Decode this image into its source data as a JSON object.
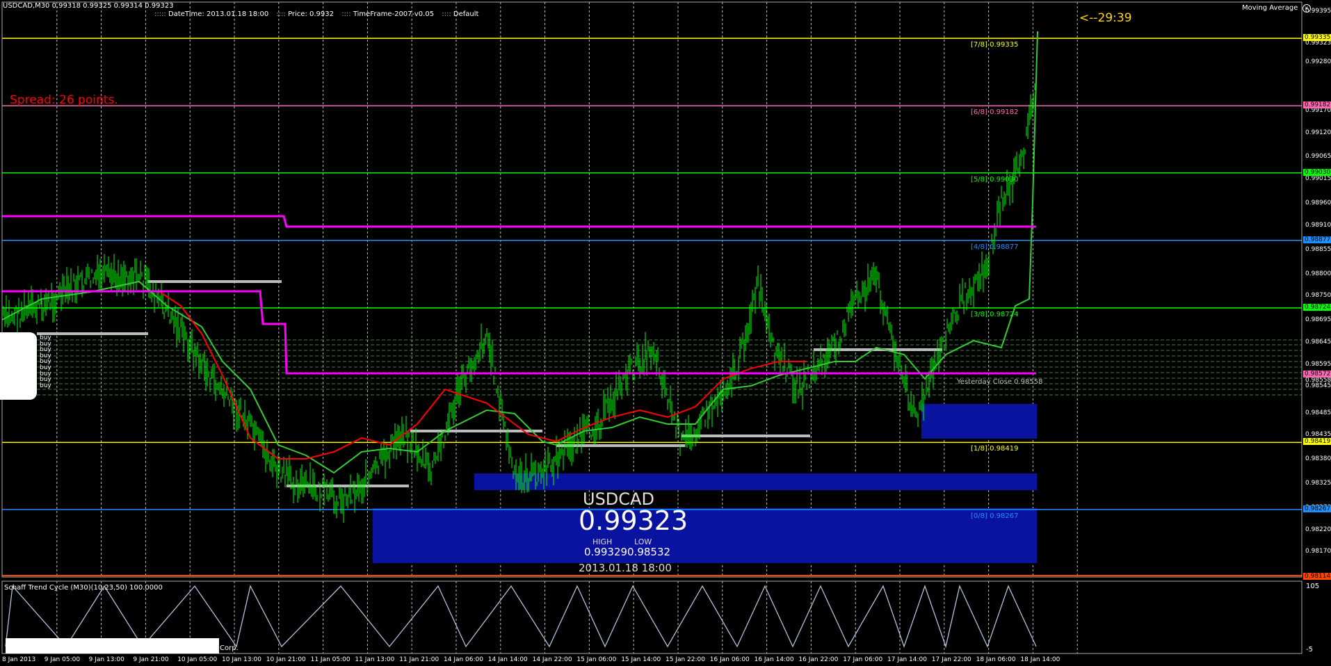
{
  "header": {
    "symbol_tf": "USDCAD,M30",
    "ohlc": "0.99318 0.99325 0.99314 0.99323",
    "datetime_label": "DateTime: 2013.01.18 18:00",
    "price_label": "Price: 0.9932",
    "timeframe_label": "TimeFrame-2007-v0.05",
    "default_label": "Default",
    "ma_label": "Moving Average",
    "countdown": "<--29:39"
  },
  "spread_text": "Spread: 26 points.",
  "murrey": [
    {
      "label": "[7/8]",
      "value": "0.99335",
      "color": "#ffff00"
    },
    {
      "label": "[6/8]",
      "value": "0.99182",
      "color": "#ff69b4"
    },
    {
      "label": "[5/8]",
      "value": "0.99030",
      "color": "#00ff00"
    },
    {
      "label": "[4/8]",
      "value": "0.98877",
      "color": "#1e90ff"
    },
    {
      "label": "[3/8]",
      "value": "0.98724",
      "color": "#00ff00"
    },
    {
      "label": "[1/8]",
      "value": "0.98419",
      "color": "#ffff00"
    },
    {
      "label": "[0/8]",
      "value": "0.98267",
      "color": "#1e90ff"
    }
  ],
  "yesterday_close": "Yesterday Close 0.98558",
  "buy_labels": [
    "buy",
    "buy",
    "buy",
    "buy",
    "buy",
    "buy",
    "buy",
    "buy",
    "buy"
  ],
  "price_axis": [
    "0.99395",
    "0.99335",
    "0.99323",
    "0.99280",
    "0.99182",
    "0.99170",
    "0.99120",
    "0.99065",
    "0.99030",
    "0.99015",
    "0.98960",
    "0.98910",
    "0.98877",
    "0.98855",
    "0.98800",
    "0.98750",
    "0.98724",
    "0.98695",
    "0.98645",
    "0.98595",
    "0.98572",
    "0.98558",
    "0.98545",
    "0.98485",
    "0.98435",
    "0.98419",
    "0.98380",
    "0.98325",
    "0.98267",
    "0.98270",
    "0.98220",
    "0.98170",
    "0.98114"
  ],
  "axis_tags": [
    {
      "value": "0.99335",
      "color": "#ffff00"
    },
    {
      "value": "0.99182",
      "color": "#ff69b4"
    },
    {
      "value": "0.99030",
      "color": "#00ff00"
    },
    {
      "value": "0.98877",
      "color": "#1e90ff"
    },
    {
      "value": "0.98724",
      "color": "#00ff00"
    },
    {
      "value": "0.98572",
      "color": "#ff69b4"
    },
    {
      "value": "0.98419",
      "color": "#ffff00"
    },
    {
      "value": "0.98267",
      "color": "#1e90ff"
    },
    {
      "value": "0.98114",
      "color": "#ff4500"
    }
  ],
  "info": {
    "symbol": "USDCAD",
    "price": "0.99323",
    "high_label": "HIGH",
    "low_label": "LOW",
    "high_low": "0.993290.98532",
    "date": "2013.01.18 18:00"
  },
  "indicator": {
    "label": "Schaff Trend Cycle (M30)(10,23,50) 100.0000",
    "scale_top": "105",
    "scale_bottom": "-5",
    "corp": "Corp."
  },
  "time_axis": [
    "8 Jan 2013",
    "9 Jan 05:00",
    "9 Jan 13:00",
    "9 Jan 21:00",
    "10 Jan 05:00",
    "10 Jan 13:00",
    "10 Jan 21:00",
    "11 Jan 05:00",
    "11 Jan 13:00",
    "11 Jan 21:00",
    "14 Jan 06:00",
    "14 Jan 14:00",
    "14 Jan 22:00",
    "15 Jan 06:00",
    "15 Jan 14:00",
    "15 Jan 22:00",
    "16 Jan 06:00",
    "16 Jan 14:00",
    "16 Jan 22:00",
    "17 Jan 06:00",
    "17 Jan 14:00",
    "17 Jan 22:00",
    "18 Jan 06:00",
    "18 Jan 14:00"
  ],
  "colors": {
    "background": "#000000",
    "bull": "#00ff00",
    "ma_red": "#ff0000",
    "ma_magenta": "#ff00ff",
    "zone_blue": "#0a12a0",
    "grid": "#c0c0c0"
  }
}
